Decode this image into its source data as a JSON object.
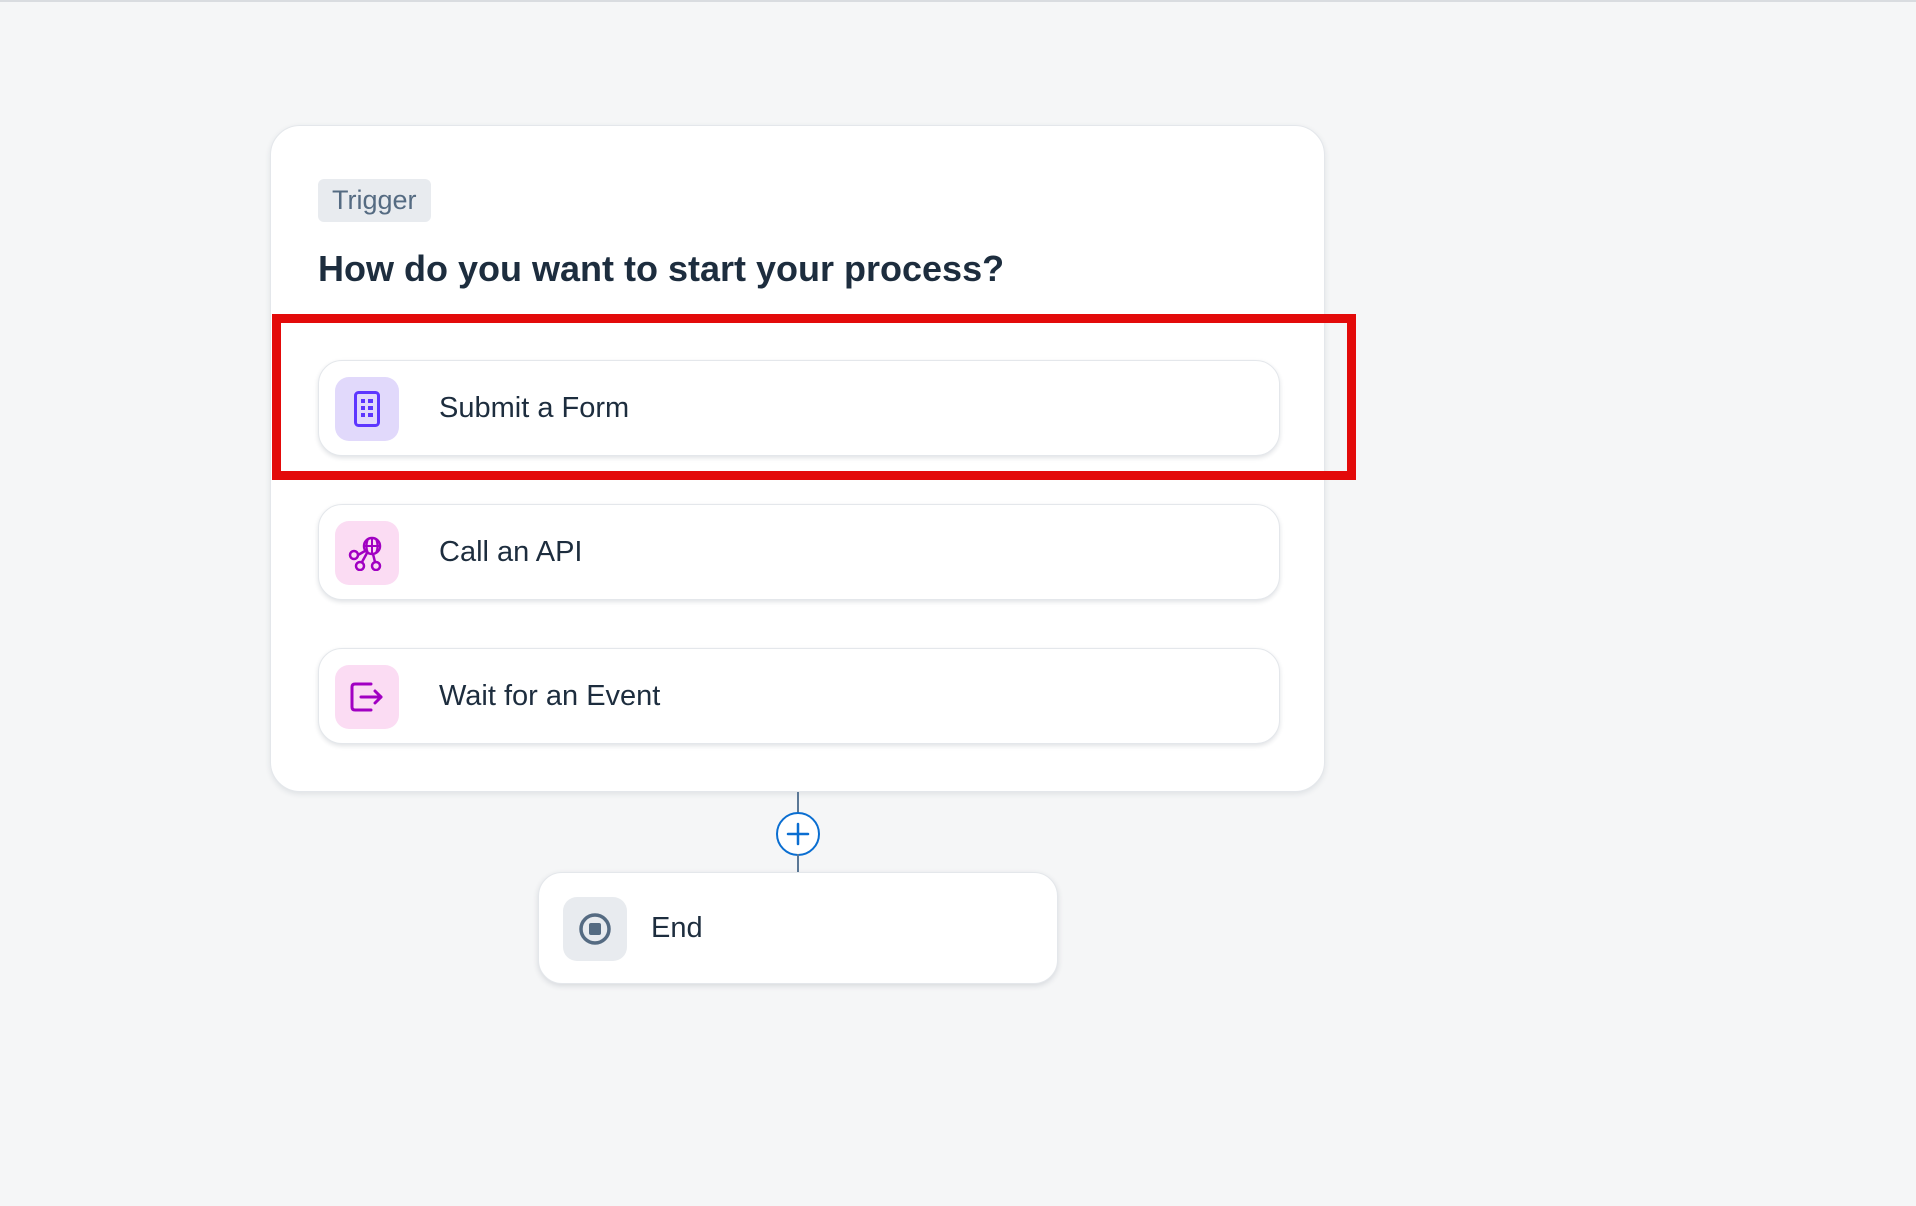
{
  "trigger": {
    "badge": "Trigger",
    "title": "How do you want to start your process?",
    "options": [
      {
        "label": "Submit a Form",
        "icon": "form-icon"
      },
      {
        "label": "Call an API",
        "icon": "api-icon"
      },
      {
        "label": "Wait for an Event",
        "icon": "event-icon"
      }
    ]
  },
  "end_node": {
    "label": "End",
    "icon": "stop-icon"
  },
  "add_step": {
    "icon": "plus-icon"
  },
  "colors": {
    "highlight": "#e30a0a",
    "form_icon": "#5d36ff",
    "api_icon": "#a100c2",
    "event_icon": "#a100c2",
    "add_button": "#0a6ed1",
    "title_text": "#1d2d3e"
  }
}
